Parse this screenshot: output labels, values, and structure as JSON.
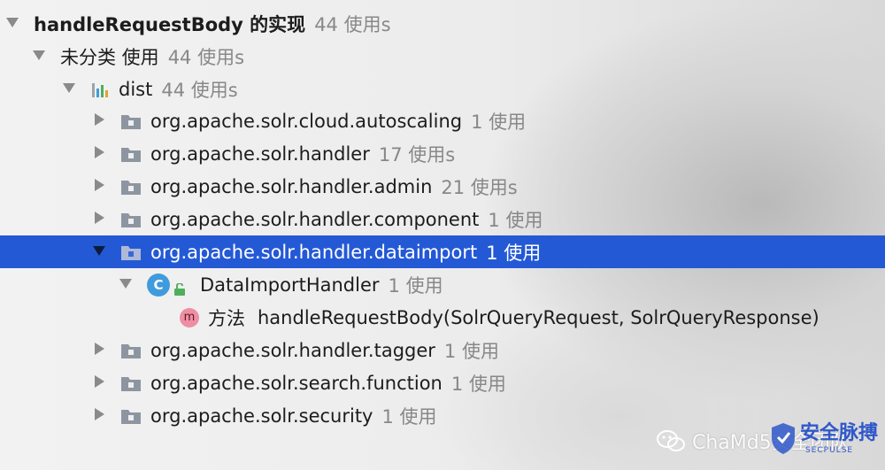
{
  "root": {
    "label": "handleRequestBody 的实现",
    "count": "44 使用s"
  },
  "category": {
    "label": "未分类 使用",
    "count": "44 使用s"
  },
  "module": {
    "label": "dist",
    "count": "44 使用s"
  },
  "packages": [
    {
      "label": "org.apache.solr.cloud.autoscaling",
      "count": "1 使用"
    },
    {
      "label": "org.apache.solr.handler",
      "count": "17 使用s"
    },
    {
      "label": "org.apache.solr.handler.admin",
      "count": "21 使用s"
    },
    {
      "label": "org.apache.solr.handler.component",
      "count": "1 使用"
    },
    {
      "label": "org.apache.solr.handler.dataimport",
      "count": "1 使用"
    },
    {
      "label": "org.apache.solr.handler.tagger",
      "count": "1 使用"
    },
    {
      "label": "org.apache.solr.search.function",
      "count": "1 使用"
    },
    {
      "label": "org.apache.solr.security",
      "count": "1 使用"
    }
  ],
  "class_node": {
    "label": "DataImportHandler",
    "count": "1 使用",
    "icon_letter": "C"
  },
  "method_node": {
    "kind": "方法",
    "signature": "handleRequestBody(SolrQueryRequest, SolrQueryResponse)",
    "icon_letter": "m"
  },
  "watermark": {
    "text": "ChaMd5安全团队",
    "brand": "安全脉搏",
    "brand_sub": "SECPULSE"
  },
  "colors": {
    "selection": "#2459d6",
    "count_text": "#888888",
    "class_icon": "#3f9bdc",
    "method_icon": "#ef8ea2",
    "folder": "#8d96a0"
  },
  "icons": {
    "expanded": "triangle-down-icon",
    "collapsed": "triangle-right-icon",
    "package": "package-folder-icon",
    "module": "module-bars-icon"
  }
}
